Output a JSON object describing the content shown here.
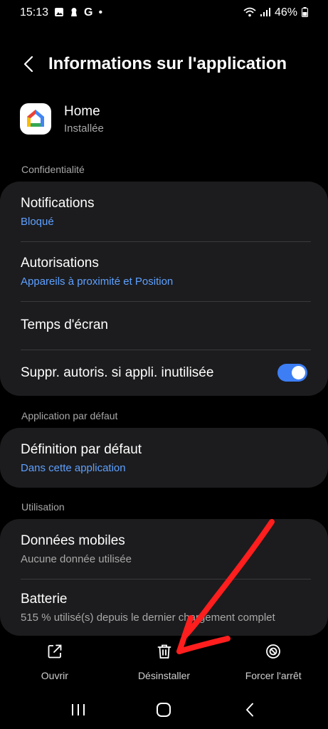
{
  "status_bar": {
    "time": "15:13",
    "battery": "46%",
    "notif_letter": "G",
    "dot": "•"
  },
  "header": {
    "title": "Informations sur l'application"
  },
  "app": {
    "name": "Home",
    "status": "Installée"
  },
  "sections": {
    "privacy": "Confidentialité",
    "default_app": "Application par défaut",
    "usage": "Utilisation"
  },
  "privacy_items": {
    "notifications_title": "Notifications",
    "notifications_sub": "Bloqué",
    "permissions_title": "Autorisations",
    "permissions_sub": "Appareils à proximité et Position",
    "screen_time_title": "Temps d'écran",
    "remove_perms_title": "Suppr. autoris. si appli. inutilisée",
    "remove_perms_enabled": true
  },
  "default_items": {
    "set_default_title": "Définition par défaut",
    "set_default_sub": "Dans cette application"
  },
  "usage_items": {
    "mobile_data_title": "Données mobiles",
    "mobile_data_sub": "Aucune donnée utilisée",
    "battery_title": "Batterie",
    "battery_sub": "515 % utilisé(s) depuis le dernier chargement complet"
  },
  "actions": {
    "open": "Ouvrir",
    "uninstall": "Désinstaller",
    "force_stop": "Forcer l'arrêt"
  },
  "colors": {
    "accent_blue": "#5ea0ff",
    "toggle_on": "#3d7ef5",
    "annotation_red": "#ff1e1e"
  }
}
